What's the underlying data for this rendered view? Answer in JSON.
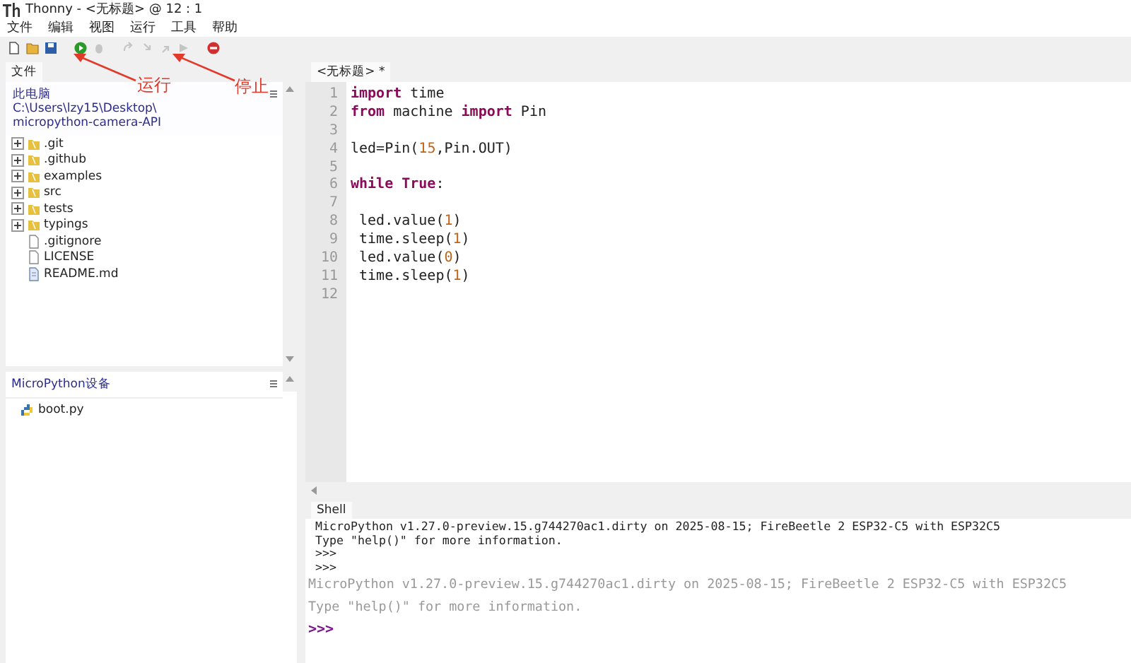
{
  "window": {
    "title": "Thonny  -  <无标题>  @  12 : 1"
  },
  "menu": [
    "文件",
    "编辑",
    "视图",
    "运行",
    "工具",
    "帮助"
  ],
  "toolbar": [
    {
      "kind": "new",
      "disabled": false
    },
    {
      "kind": "open",
      "disabled": false
    },
    {
      "kind": "save",
      "disabled": false
    },
    {
      "kind": "run",
      "disabled": false
    },
    {
      "kind": "debug",
      "disabled": true
    },
    {
      "kind": "step-over",
      "disabled": true
    },
    {
      "kind": "step-into",
      "disabled": true
    },
    {
      "kind": "step-out",
      "disabled": true
    },
    {
      "kind": "resume",
      "disabled": true
    },
    {
      "kind": "stop",
      "disabled": false
    }
  ],
  "annotations": [
    {
      "label": "运行"
    },
    {
      "label": "停止"
    }
  ],
  "files_panel": {
    "tab": "文件",
    "path": [
      "此电脑",
      "C:\\Users\\lzy15\\Desktop\\",
      "micropython-camera-API"
    ],
    "items": [
      {
        "name": ".git",
        "kind": "folder"
      },
      {
        "name": ".github",
        "kind": "folder"
      },
      {
        "name": "examples",
        "kind": "folder"
      },
      {
        "name": "src",
        "kind": "folder"
      },
      {
        "name": "tests",
        "kind": "folder"
      },
      {
        "name": "typings",
        "kind": "folder"
      },
      {
        "name": ".gitignore",
        "kind": "file"
      },
      {
        "name": "LICENSE",
        "kind": "file"
      },
      {
        "name": "README.md",
        "kind": "doc"
      }
    ]
  },
  "device_panel": {
    "title": "MicroPython设备",
    "items": [
      {
        "name": "boot.py",
        "kind": "python"
      }
    ]
  },
  "editor": {
    "tab": "<无标题> *",
    "lines": [
      {
        "num": "1",
        "tokens": [
          {
            "kind": "kw",
            "text": "import"
          },
          {
            "kind": "plain",
            "text": " time"
          }
        ]
      },
      {
        "num": "2",
        "tokens": [
          {
            "kind": "kw",
            "text": "from"
          },
          {
            "kind": "plain",
            "text": " machine "
          },
          {
            "kind": "kw",
            "text": "import"
          },
          {
            "kind": "plain",
            "text": " Pin"
          }
        ]
      },
      {
        "num": "3"
      },
      {
        "num": "4",
        "tokens": [
          {
            "kind": "plain",
            "text": "led=Pin("
          },
          {
            "kind": "num",
            "text": "15"
          },
          {
            "kind": "plain",
            "text": ",Pin.OUT)"
          }
        ]
      },
      {
        "num": "5"
      },
      {
        "num": "6",
        "tokens": [
          {
            "kind": "kw",
            "text": "while True"
          },
          {
            "kind": "plain",
            "text": ":"
          }
        ]
      },
      {
        "num": "7"
      },
      {
        "num": "8",
        "tokens": [
          {
            "kind": "plain",
            "text": " led.value("
          },
          {
            "kind": "num",
            "text": "1"
          },
          {
            "kind": "plain",
            "text": ")"
          }
        ]
      },
      {
        "num": "9",
        "tokens": [
          {
            "kind": "plain",
            "text": " time.sleep("
          },
          {
            "kind": "num",
            "text": "1"
          },
          {
            "kind": "plain",
            "text": ")"
          }
        ]
      },
      {
        "num": "10",
        "tokens": [
          {
            "kind": "plain",
            "text": " led.value("
          },
          {
            "kind": "num",
            "text": "0"
          },
          {
            "kind": "plain",
            "text": ")"
          }
        ]
      },
      {
        "num": "11",
        "tokens": [
          {
            "kind": "plain",
            "text": " time.sleep("
          },
          {
            "kind": "num",
            "text": "1"
          },
          {
            "kind": "plain",
            "text": ")"
          }
        ]
      },
      {
        "num": "12"
      }
    ]
  },
  "shell": {
    "tab": "Shell",
    "lines": [
      {
        "kind": "output",
        "text": " MicroPython v1.27.0-preview.15.g744270ac1.dirty on 2025-08-15; FireBeetle 2 ESP32-C5 with ESP32C5"
      },
      {
        "kind": "output",
        "text": " Type \"help()\" for more information."
      },
      {
        "kind": "output",
        "text": " >>>"
      },
      {
        "kind": "output",
        "text": " >>>"
      },
      {
        "kind": "banner",
        "text": "MicroPython v1.27.0-preview.15.g744270ac1.dirty on 2025-08-15; FireBeetle 2 ESP32-C5 with ESP32C5"
      },
      {
        "kind": "banner",
        "text": "Type \"help()\" for more information."
      },
      {
        "kind": "prompt",
        "text": ">>>"
      }
    ]
  }
}
